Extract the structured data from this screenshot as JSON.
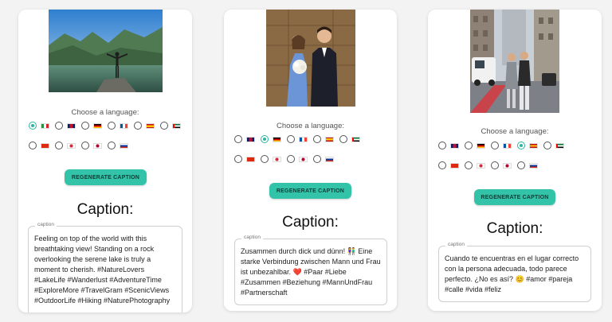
{
  "cards": [
    {
      "language_prompt": "Choose a language:",
      "button_label": "REGENERATE CAPTION",
      "caption_heading": "Caption:",
      "caption_legend": "caption",
      "caption_text": "Feeling on top of the world with this breathtaking view! Standing on a rock overlooking the serene lake is truly a moment to cherish. #NatureLovers #LakeLife #Wanderlust #AdventureTime #ExploreMore #TravelGram #ScenicViews #OutdoorLife #Hiking #NaturePhotography",
      "selected_language": "Italian"
    },
    {
      "language_prompt": "Choose a language:",
      "button_label": "REGENERATE CAPTION",
      "caption_heading": "Caption:",
      "caption_legend": "caption",
      "caption_text": "Zusammen durch dick und dünn! 👫 Eine starke Verbindung zwischen Mann und Frau ist unbezahlbar. ❤️ #Paar #Liebe #Zusammen #Beziehung #MannUndFrau #Partnerschaft",
      "selected_language": "German"
    },
    {
      "language_prompt": "Choose a language:",
      "button_label": "REGENERATE CAPTION",
      "caption_heading": "Caption:",
      "caption_legend": "caption",
      "caption_text": "Cuando te encuentras en el lugar correcto con la persona adecuada, todo parece perfecto. ¿No es así? 😊 #amor #pareja #calle #vida #feliz",
      "selected_language": "Spanish"
    }
  ],
  "languages_row1": [
    "Italian",
    "English",
    "German",
    "French",
    "Spanish",
    "Arabic"
  ],
  "languages_row2": [
    "Chinese",
    "Korean",
    "Japanese",
    "Russian"
  ],
  "colors": {
    "accent": "#33c3a8",
    "radio_selected": "#2bb5a0"
  }
}
